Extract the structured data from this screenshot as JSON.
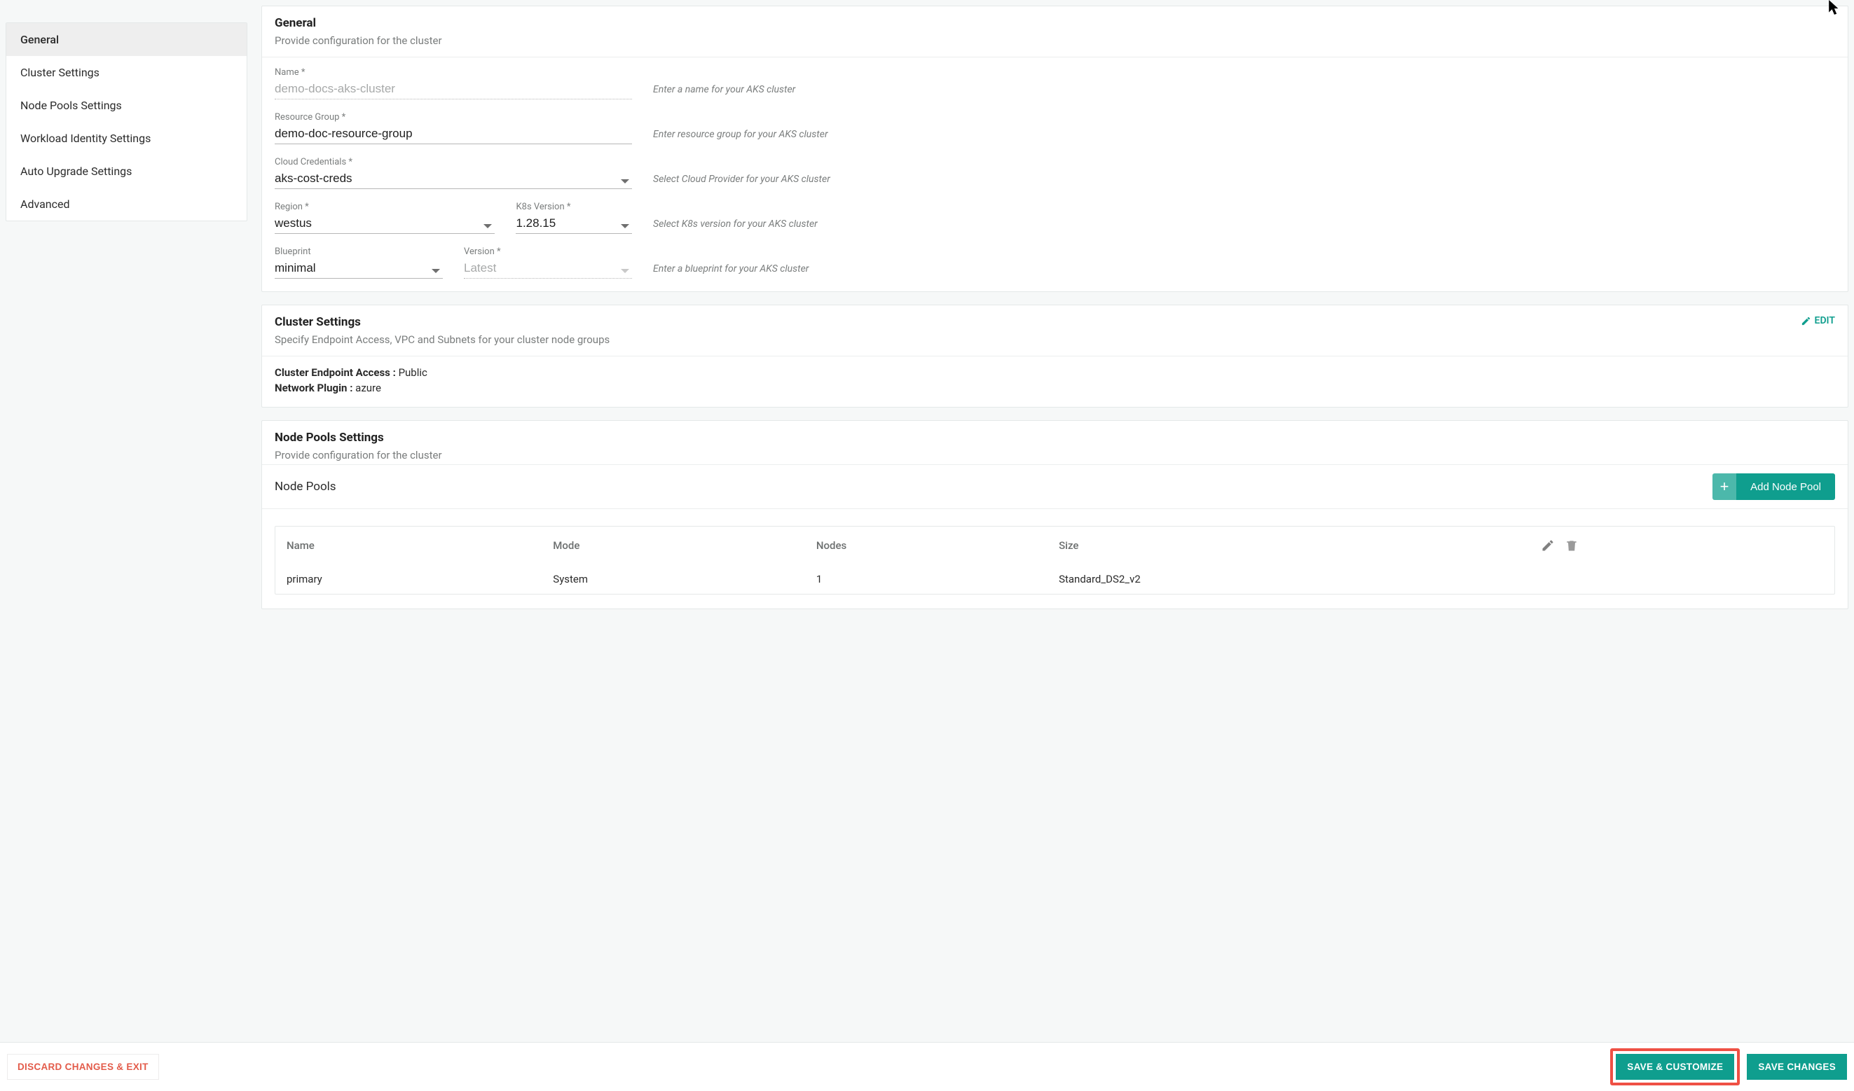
{
  "sidebar": {
    "items": [
      {
        "label": "General",
        "active": true
      },
      {
        "label": "Cluster Settings",
        "active": false
      },
      {
        "label": "Node Pools Settings",
        "active": false
      },
      {
        "label": "Workload Identity Settings",
        "active": false
      },
      {
        "label": "Auto Upgrade Settings",
        "active": false
      },
      {
        "label": "Advanced",
        "active": false
      }
    ]
  },
  "general": {
    "title": "General",
    "subtitle": "Provide configuration for the cluster",
    "fields": {
      "name": {
        "label": "Name *",
        "value": "demo-docs-aks-cluster",
        "helper": "Enter a name for your AKS cluster"
      },
      "resource_group": {
        "label": "Resource Group *",
        "value": "demo-doc-resource-group",
        "helper": "Enter resource group for your AKS cluster"
      },
      "cloud_credentials": {
        "label": "Cloud Credentials *",
        "value": "aks-cost-creds",
        "helper": "Select Cloud Provider for your AKS cluster"
      },
      "region": {
        "label": "Region *",
        "value": "westus"
      },
      "k8s_version": {
        "label": "K8s Version *",
        "value": "1.28.15",
        "helper": "Select K8s version for your AKS cluster"
      },
      "blueprint": {
        "label": "Blueprint",
        "value": "minimal"
      },
      "version": {
        "label": "Version *",
        "value": "Latest",
        "helper": "Enter a blueprint for your AKS cluster"
      }
    }
  },
  "cluster_settings": {
    "title": "Cluster Settings",
    "subtitle": "Specify Endpoint Access, VPC and Subnets for your cluster node groups",
    "edit_label": "EDIT",
    "endpoint_label": "Cluster Endpoint Access :",
    "endpoint_value": "Public",
    "plugin_label": "Network Plugin :",
    "plugin_value": "azure"
  },
  "node_pools": {
    "title": "Node Pools Settings",
    "subtitle": "Provide configuration for the cluster",
    "section_label": "Node Pools",
    "add_button": "Add Node Pool",
    "columns": {
      "name": "Name",
      "mode": "Mode",
      "nodes": "Nodes",
      "size": "Size"
    },
    "rows": [
      {
        "name": "primary",
        "mode": "System",
        "nodes": "1",
        "size": "Standard_DS2_v2"
      }
    ]
  },
  "bottom_bar": {
    "discard": "DISCARD CHANGES & EXIT",
    "save_customize": "SAVE & CUSTOMIZE",
    "save_changes": "SAVE CHANGES"
  }
}
